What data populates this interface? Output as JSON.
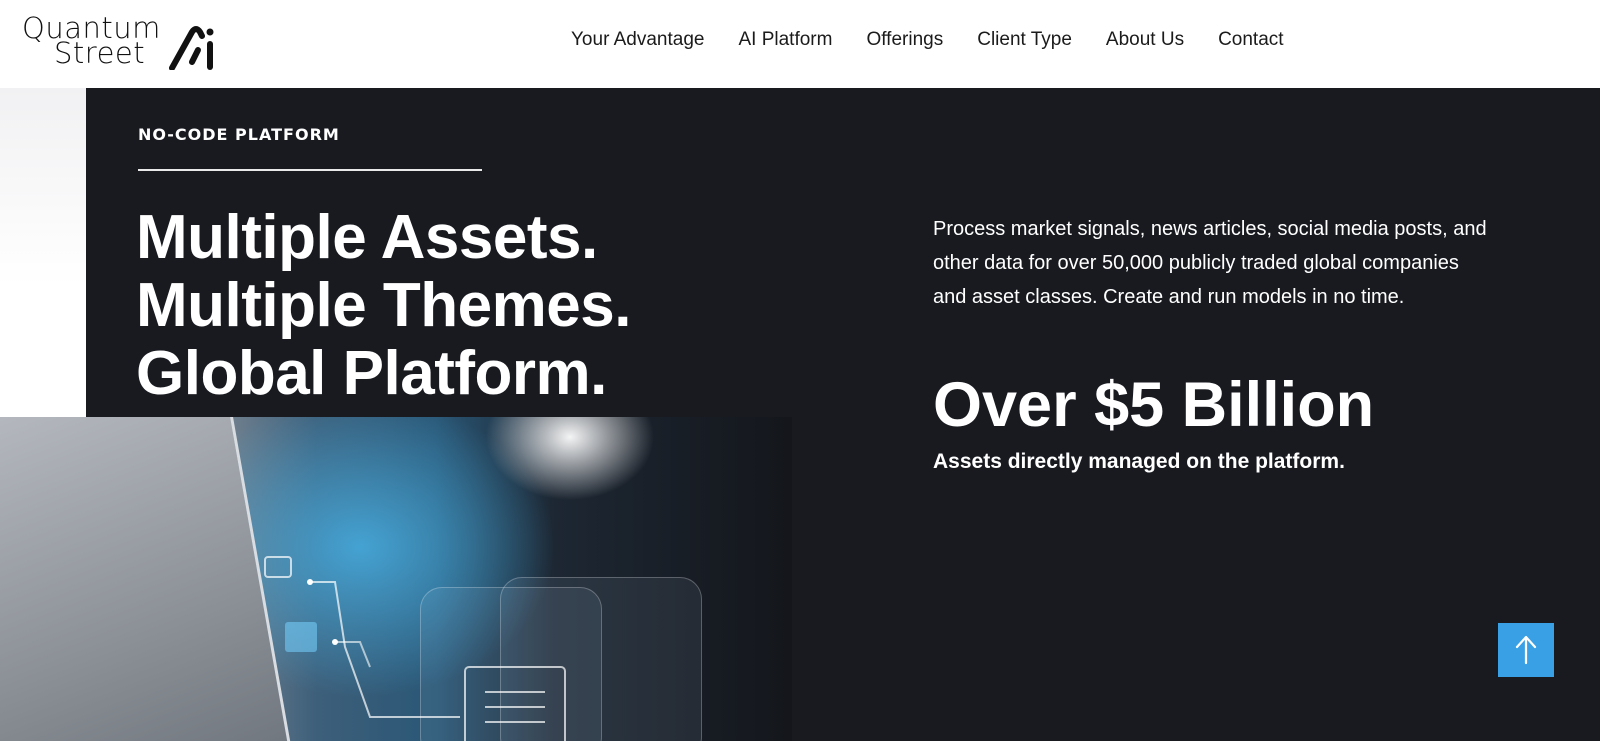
{
  "brand": {
    "logo_line1": "Quantum",
    "logo_line2": "Street"
  },
  "nav": {
    "items": [
      "Your Advantage",
      "AI Platform",
      "Offerings",
      "Client Type",
      "About Us",
      "Contact"
    ]
  },
  "hero": {
    "eyebrow": "NO-CODE PLATFORM",
    "headline": "Multiple Assets. Multiple Themes. Global Platform.",
    "description": "Process market signals, news articles, social media posts, and other data for over 50,000 publicly traded global companies and asset classes. Create and run models in no time.",
    "stat_value": "Over $5 Billion",
    "stat_label": "Assets directly managed on the platform."
  },
  "colors": {
    "dark_bg": "#181a20",
    "accent": "#3aa0e6"
  },
  "icons": {
    "scroll_top": "arrow-up-icon"
  }
}
